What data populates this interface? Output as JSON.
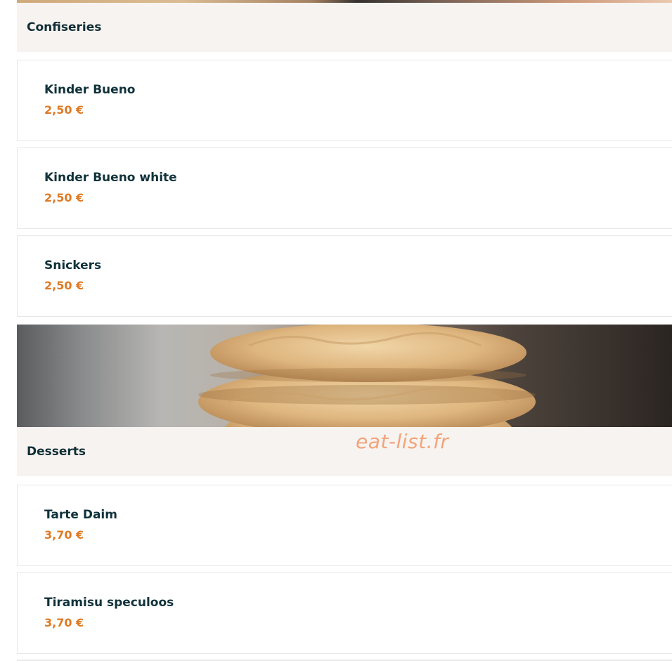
{
  "categories": [
    {
      "title": "Confiseries",
      "items": [
        {
          "name": "Kinder Bueno",
          "price": "2,50 €"
        },
        {
          "name": "Kinder Bueno white",
          "price": "2,50 €"
        },
        {
          "name": "Snickers",
          "price": "2,50 €"
        }
      ]
    },
    {
      "title": "Desserts",
      "items": [
        {
          "name": "Tarte Daim",
          "price": "3,70 €"
        },
        {
          "name": "Tiramisu speculoos",
          "price": "3,70 €"
        }
      ]
    }
  ],
  "watermark": "eat-list.fr",
  "colors": {
    "price": "#de7a25",
    "header_bg": "#f7f3f0",
    "text": "#10323a"
  }
}
